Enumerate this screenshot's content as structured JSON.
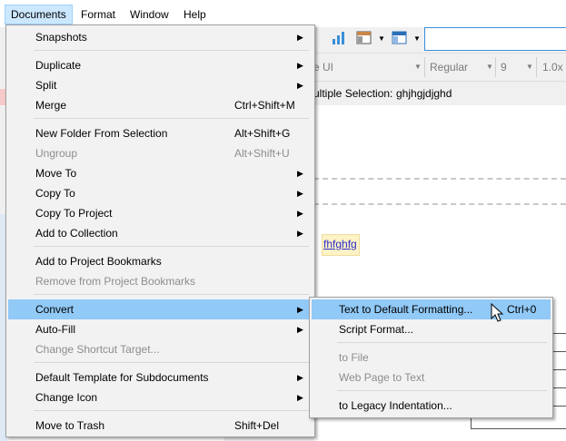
{
  "menubar": {
    "items": [
      {
        "label": "Documents"
      },
      {
        "label": "Format"
      },
      {
        "label": "Window"
      },
      {
        "label": "Help"
      }
    ]
  },
  "toolbar": {
    "font_family_fragment": "e UI",
    "font_style": "Regular",
    "font_size": "9",
    "line_spacing": "1.0x"
  },
  "selection_bar": {
    "label": "ultiple Selection:",
    "value": "ghjhgjdjghd"
  },
  "editor": {
    "link_text": "fhfghfg"
  },
  "documents_menu": {
    "items": [
      {
        "label": "Snapshots",
        "submenu": true
      },
      {
        "label": "Duplicate",
        "submenu": true
      },
      {
        "label": "Split",
        "submenu": true
      },
      {
        "label": "Merge",
        "shortcut": "Ctrl+Shift+M"
      },
      {
        "label": "New Folder From Selection",
        "shortcut": "Alt+Shift+G"
      },
      {
        "label": "Ungroup",
        "shortcut": "Alt+Shift+U",
        "disabled": true
      },
      {
        "label": "Move To",
        "submenu": true
      },
      {
        "label": "Copy To",
        "submenu": true
      },
      {
        "label": "Copy To Project",
        "submenu": true
      },
      {
        "label": "Add to Collection",
        "submenu": true
      },
      {
        "label": "Add to Project Bookmarks"
      },
      {
        "label": "Remove from Project Bookmarks",
        "disabled": true
      },
      {
        "label": "Convert",
        "submenu": true,
        "highlighted": true
      },
      {
        "label": "Auto-Fill",
        "submenu": true
      },
      {
        "label": "Change Shortcut Target...",
        "disabled": true
      },
      {
        "label": "Default Template for Subdocuments",
        "submenu": true
      },
      {
        "label": "Change Icon",
        "submenu": true
      },
      {
        "label": "Move to Trash",
        "shortcut": "Shift+Del"
      }
    ]
  },
  "convert_submenu": {
    "items": [
      {
        "label": "Text to Default Formatting...",
        "shortcut": "Ctrl+0",
        "highlighted": true
      },
      {
        "label": "Script Format..."
      },
      {
        "label": "to File",
        "disabled": true
      },
      {
        "label": "Web Page to Text",
        "disabled": true
      },
      {
        "label": "to Legacy Indentation..."
      }
    ]
  },
  "icons": [
    "chart-icon",
    "layout-icon",
    "panel-icon",
    "submenu-arrow-icon",
    "mouse-pointer-icon"
  ],
  "colors": {
    "menu_bg": "#f2f2f2",
    "highlight": "#91c9f7",
    "menubar_active": "#cce8ff",
    "disabled_text": "#8d8d8d",
    "link": "#2a2ad0"
  }
}
